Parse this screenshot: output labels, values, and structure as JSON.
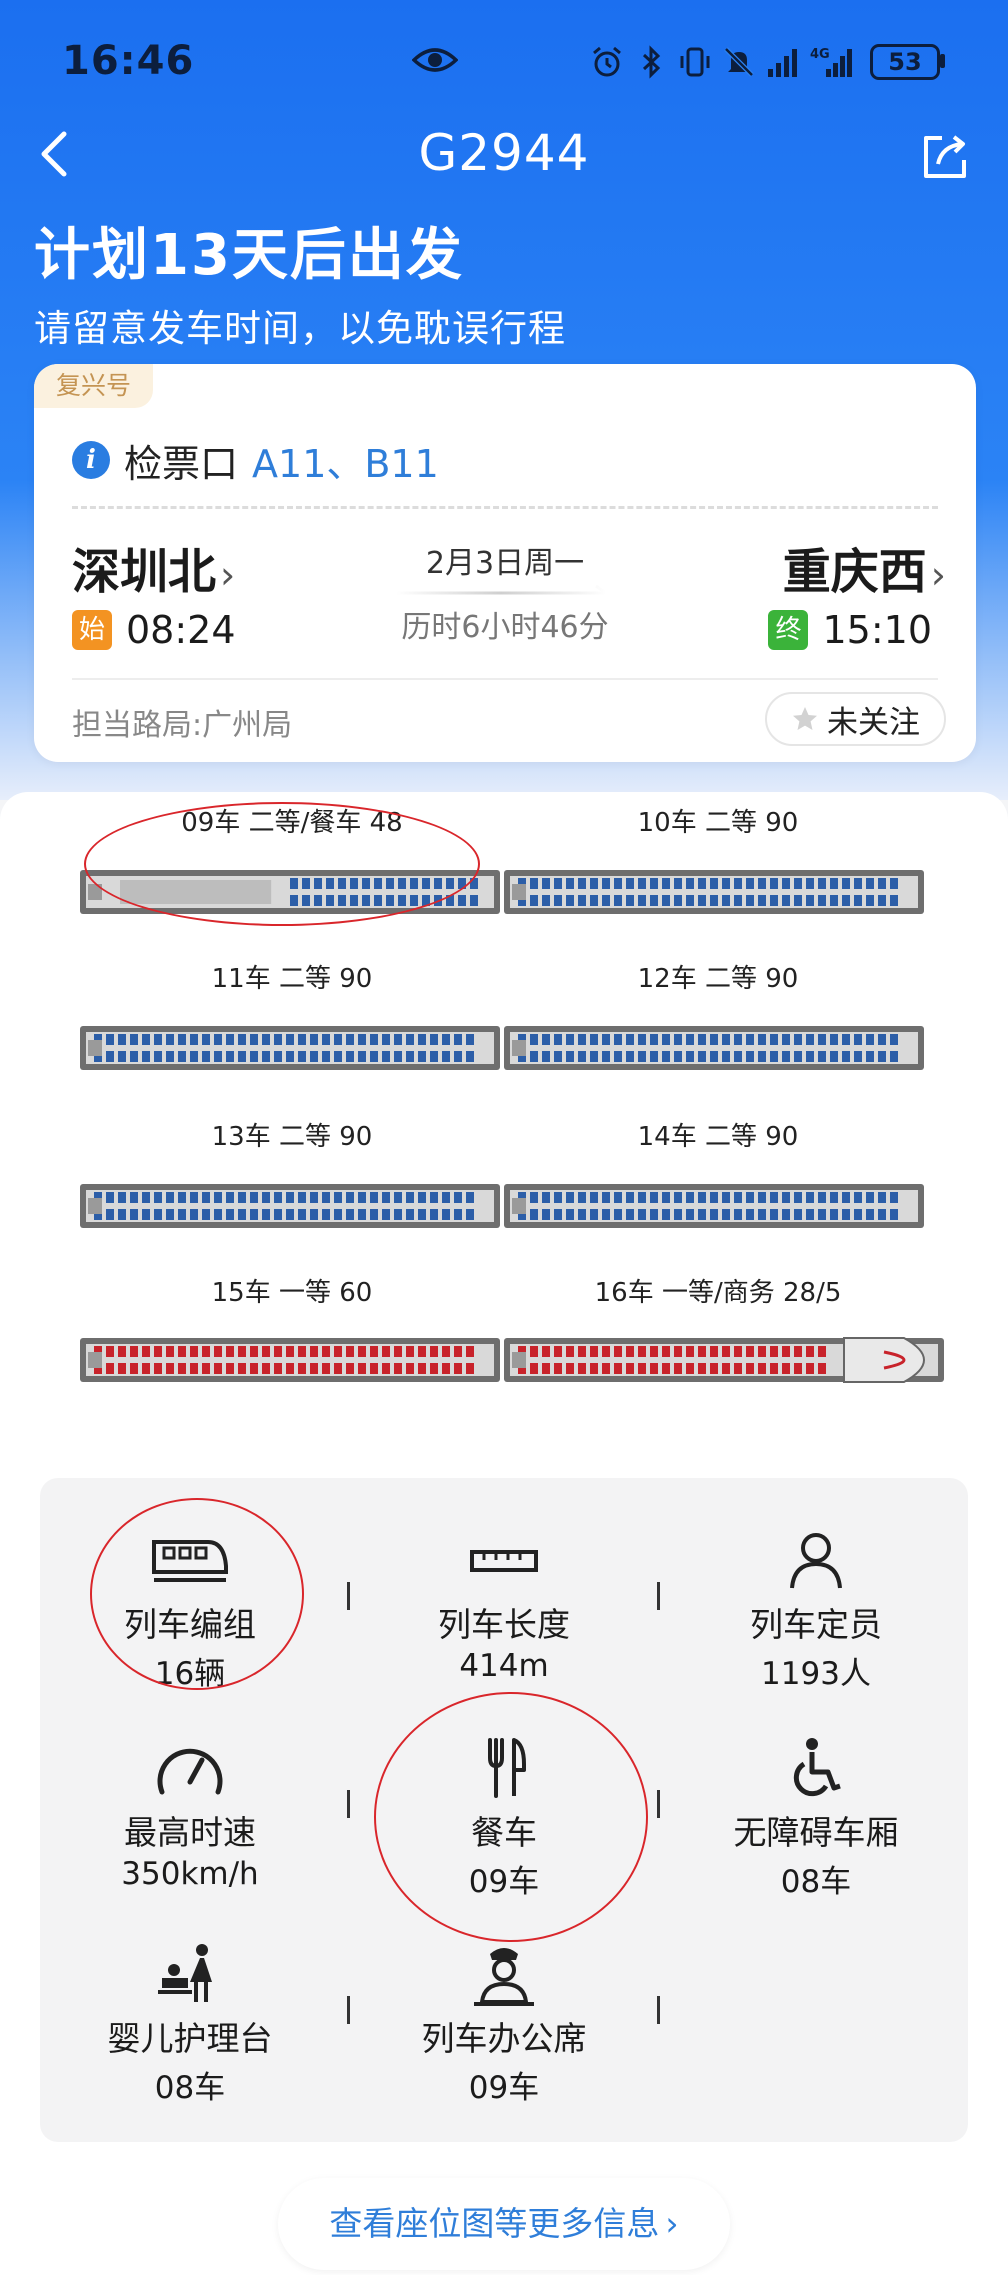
{
  "status_bar": {
    "time": "16:46",
    "battery": "53",
    "icons": [
      "eye-icon",
      "alarm-icon",
      "bluetooth-icon",
      "vibrate-icon",
      "mute-icon",
      "signal-icon",
      "4g-signal-icon",
      "battery-icon"
    ]
  },
  "nav": {
    "title": "G2944",
    "back_icon": "back-arrow-icon",
    "share_icon": "share-icon"
  },
  "hero": {
    "title": "计划13天后出发",
    "subtitle": "请留意发车时间，以免耽误行程"
  },
  "trip": {
    "train_type": "复兴号",
    "gate_label": "检票口",
    "gate_value": "A11、B11",
    "from_station": "深圳北",
    "to_station": "重庆西",
    "from_badge": "始",
    "to_badge": "终",
    "depart_time": "08:24",
    "arrive_time": "15:10",
    "date": "2月3日周一",
    "duration": "历时6小时46分",
    "bureau": "担当路局:广州局",
    "follow_label": "未关注",
    "colors": {
      "start_badge": "#f39322",
      "end_badge": "#3bb33a",
      "link": "#2f7ed9"
    }
  },
  "cars": [
    {
      "label": "09车 二等/餐车 48",
      "seat_class": "second",
      "dining": true
    },
    {
      "label": "10车 二等 90",
      "seat_class": "second"
    },
    {
      "label": "11车 二等 90",
      "seat_class": "second"
    },
    {
      "label": "12车 二等 90",
      "seat_class": "second"
    },
    {
      "label": "13车 二等 90",
      "seat_class": "second"
    },
    {
      "label": "14车 二等 90",
      "seat_class": "second"
    },
    {
      "label": "15车 一等 60",
      "seat_class": "first"
    },
    {
      "label": "16车 一等/商务 28/5",
      "seat_class": "first",
      "head": true
    }
  ],
  "stats": [
    {
      "label": "列车编组",
      "value": "16辆",
      "icon": "train-icon"
    },
    {
      "label": "列车长度",
      "value": "414m",
      "icon": "ruler-icon"
    },
    {
      "label": "列车定员",
      "value": "1193人",
      "icon": "person-icon"
    },
    {
      "label": "最高时速",
      "value": "350km/h",
      "icon": "speedometer-icon"
    },
    {
      "label": "餐车",
      "value": "09车",
      "icon": "dining-icon"
    },
    {
      "label": "无障碍车厢",
      "value": "08车",
      "icon": "wheelchair-icon"
    },
    {
      "label": "婴儿护理台",
      "value": "08车",
      "icon": "baby-care-icon"
    },
    {
      "label": "列车办公席",
      "value": "09车",
      "icon": "conductor-icon"
    }
  ],
  "more_button": {
    "label": "查看座位图等更多信息",
    "icon": "chevron-right-icon"
  }
}
